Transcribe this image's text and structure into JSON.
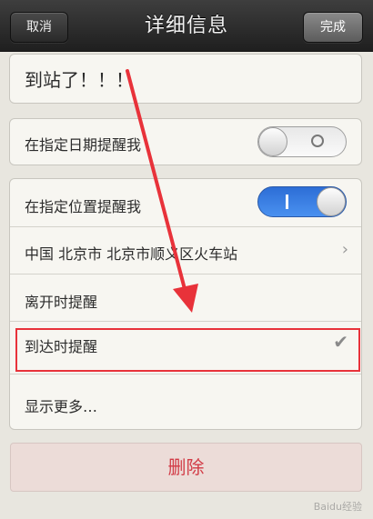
{
  "navbar": {
    "cancel_label": "取消",
    "title": "详细信息",
    "done_label": "完成"
  },
  "reminder": {
    "title_text": "到站了！！！"
  },
  "date_remind": {
    "label": "在指定日期提醒我",
    "enabled": false
  },
  "location_remind": {
    "label": "在指定位置提醒我",
    "enabled": true,
    "location_text": "中国 北京市 北京市顺义区火车站",
    "leave_label": "离开时提醒",
    "arrive_label": "到达时提醒",
    "arrive_selected": true
  },
  "more": {
    "label": "显示更多…"
  },
  "delete_label": "删除",
  "colors": {
    "accent_blue": "#2d6ed6",
    "highlight_red": "#e8323a",
    "delete_red": "#d23b46"
  },
  "watermark_text": "Baidu经验"
}
